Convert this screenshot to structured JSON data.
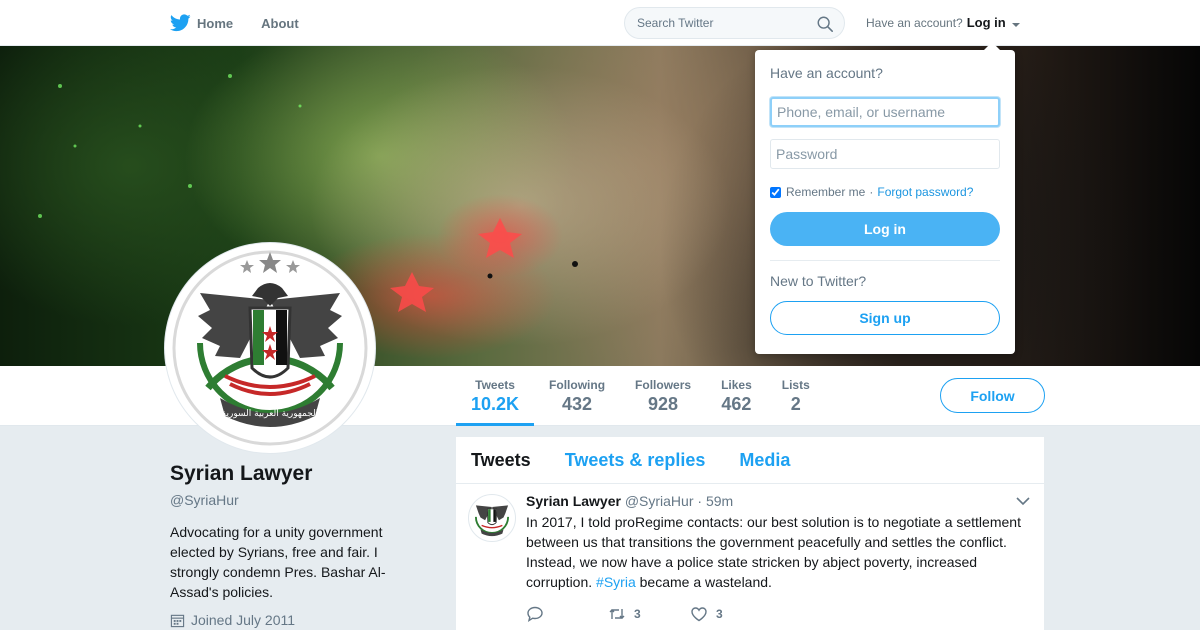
{
  "nav": {
    "home_label": "Home",
    "about_label": "About",
    "search_placeholder": "Search Twitter",
    "have_account_text": "Have an account?",
    "login_label": "Log in",
    "brand_icon": "twitter-bird-icon",
    "brand_color": "#1da1f2"
  },
  "login_dropdown": {
    "title": "Have an account?",
    "username_placeholder": "Phone, email, or username",
    "password_placeholder": "Password",
    "remember_label": "Remember me",
    "separator": "·",
    "forgot_label": "Forgot password?",
    "login_button": "Log in",
    "new_text": "New to Twitter?",
    "signup_button": "Sign up"
  },
  "profile": {
    "name": "Syrian Lawyer",
    "handle": "@SyriaHur",
    "bio": "Advocating for a unity government elected by Syrians, free and fair. I strongly condemn Pres. Bashar Al-Assad's policies.",
    "joined": "Joined July 2011",
    "avatar_text": "الجمهورية العربية السورية"
  },
  "stats": [
    {
      "label": "Tweets",
      "value": "10.2K"
    },
    {
      "label": "Following",
      "value": "432"
    },
    {
      "label": "Followers",
      "value": "928"
    },
    {
      "label": "Likes",
      "value": "462"
    },
    {
      "label": "Lists",
      "value": "2"
    }
  ],
  "follow_button": "Follow",
  "tabs": [
    "Tweets",
    "Tweets & replies",
    "Media"
  ],
  "tweet": {
    "name": "Syrian Lawyer",
    "handle": "@SyriaHur",
    "separator": "·",
    "time": "59m",
    "text_before": "In 2017, I told proRegime contacts: our best solution is to negotiate a settlement between us that transitions the government peacefully and settles the conflict. Instead, we now have a police state stricken by abject poverty, increased corruption. ",
    "hashtag": "#Syria",
    "text_after": " became a wasteland.",
    "reply_count": "",
    "retweet_count": "3",
    "like_count": "3"
  },
  "colors": {
    "accent": "#1da1f2",
    "background": "#e6ecf0"
  }
}
